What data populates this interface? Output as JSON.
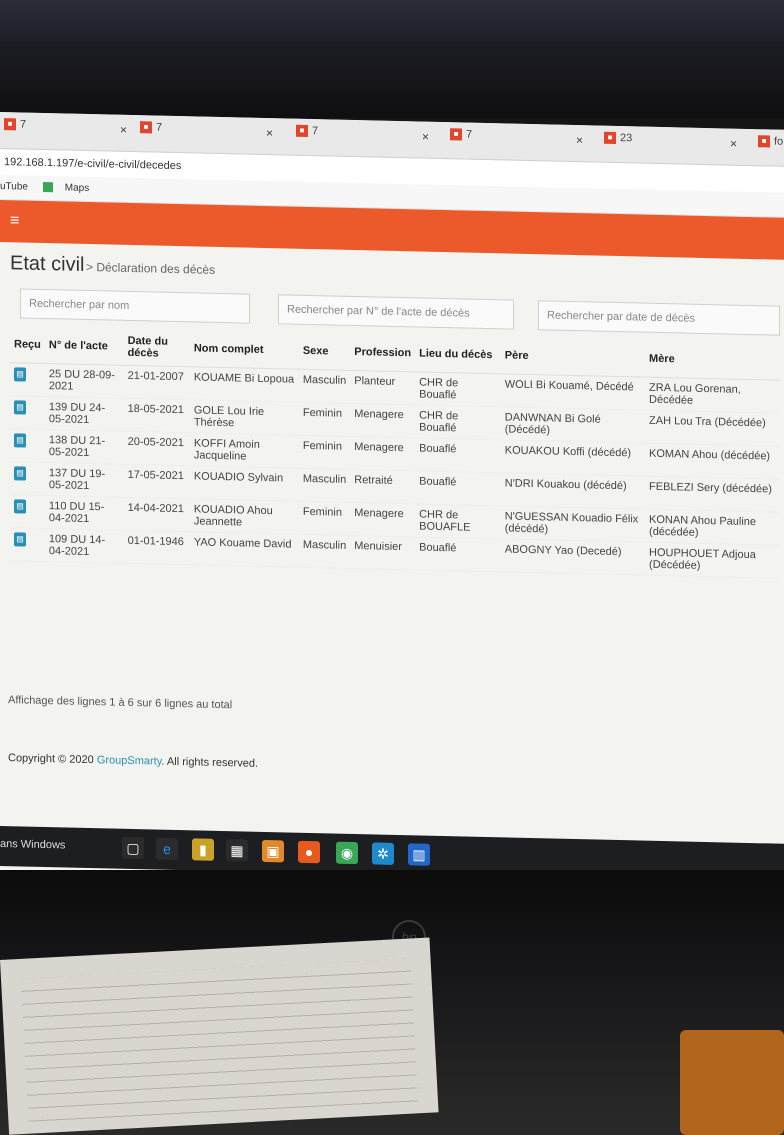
{
  "browser": {
    "tabs": [
      {
        "label": "7"
      },
      {
        "label": "7"
      },
      {
        "label": "7"
      },
      {
        "label": "7"
      },
      {
        "label": "23"
      }
    ],
    "close_glyph": "×",
    "overflow_tab": "fo",
    "url": "192.168.1.197/e-civil/e-civil/decedes",
    "bookmarks": {
      "youtube": "uTube",
      "maps": "Maps"
    }
  },
  "app": {
    "menu_icon": "≡",
    "title": "Etat civil",
    "breadcrumb": "> Déclaration des décès"
  },
  "search": {
    "by_name": "Rechercher par nom",
    "by_number": "Rechercher par N° de l'acte de décès",
    "by_date": "Rechercher par date de décès"
  },
  "table": {
    "headers": [
      "Reçu",
      "N° de l'acte",
      "Date du décès",
      "Nom complet",
      "Sexe",
      "Profession",
      "Lieu du décès",
      "Père",
      "Mère"
    ],
    "rows": [
      {
        "acte": "25 DU 28-09-2021",
        "date": "21-01-2007",
        "nom": "KOUAME Bi Lopoua",
        "sexe": "Masculin",
        "profession": "Planteur",
        "lieu": "CHR de Bouaflé",
        "pere": "WOLI Bi Kouamé, Décédé",
        "mere": "ZRA Lou Gorenan, Décédée"
      },
      {
        "acte": "139 DU 24-05-2021",
        "date": "18-05-2021",
        "nom": "GOLE Lou Irie Thérèse",
        "sexe": "Feminin",
        "profession": "Menagere",
        "lieu": "CHR de Bouaflé",
        "pere": "DANWNAN Bi Golé (Décédé)",
        "mere": "ZAH Lou Tra (Décédée)"
      },
      {
        "acte": "138 DU 21-05-2021",
        "date": "20-05-2021",
        "nom": "KOFFI Amoin Jacqueline",
        "sexe": "Feminin",
        "profession": "Menagere",
        "lieu": "Bouaflé",
        "pere": "KOUAKOU Koffi (décédé)",
        "mere": "KOMAN Ahou (décédée)"
      },
      {
        "acte": "137 DU 19-05-2021",
        "date": "17-05-2021",
        "nom": "KOUADIO Sylvain",
        "sexe": "Masculin",
        "profession": "Retraité",
        "lieu": "Bouaflé",
        "pere": "N'DRI Kouakou (décédé)",
        "mere": "FEBLEZI Sery (décédée)"
      },
      {
        "acte": "110 DU 15-04-2021",
        "date": "14-04-2021",
        "nom": "KOUADIO Ahou Jeannette",
        "sexe": "Feminin",
        "profession": "Menagere",
        "lieu": "CHR de BOUAFLE",
        "pere": "N'GUESSAN Kouadio Félix (décédé)",
        "mere": "KONAN Ahou Pauline (décédée)"
      },
      {
        "acte": "109 DU 14-04-2021",
        "date": "01-01-1946",
        "nom": "YAO Kouame David",
        "sexe": "Masculin",
        "profession": "Menuisier",
        "lieu": "Bouaflé",
        "pere": "ABOGNY Yao (Decedé)",
        "mere": "HOUPHOUET Adjoua (Décédée)"
      }
    ]
  },
  "footer": {
    "summary": "Affichage des lignes 1 à 6 sur 6 lignes au total",
    "copyright_prefix": "Copyright © 2020",
    "brand": "GroupSmarty",
    "copyright_suffix": ". All rights reserved."
  },
  "taskbar": {
    "search_text": "ans Windows"
  },
  "colors": {
    "accent": "#ec5a2c",
    "icon_blue": "#2a8fb5"
  }
}
